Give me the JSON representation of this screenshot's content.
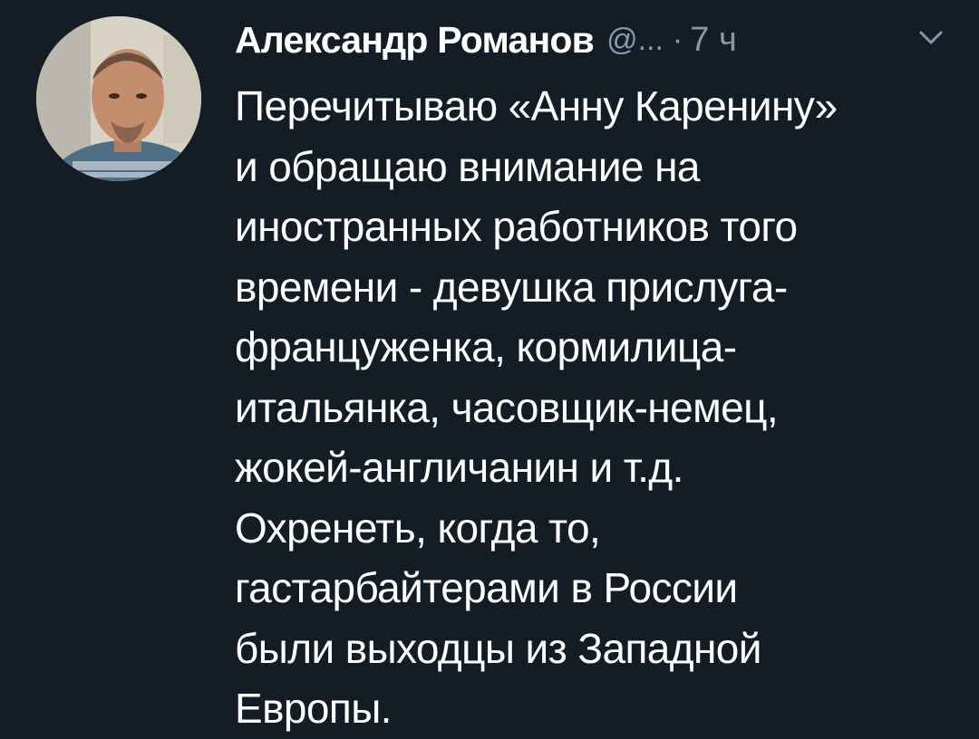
{
  "tweet": {
    "author_name": "Александр Романов",
    "handle": "@...",
    "separator": "·",
    "time": "7 ч",
    "avatar_icon": "user-avatar-photo",
    "menu_icon": "chevron-down-icon",
    "text_lines": [
      "Перечитываю «Анну Каренину»",
      "и обращаю внимание на",
      "иностранных работников того",
      "времени - девушка прислуга-",
      "француженка, кормилица-",
      "итальянка, часовщик-немец,",
      "жокей-англичанин и т.д.",
      "Охренеть, когда то,",
      "гастарбайтерами в России",
      "были выходцы из Западной",
      "Европы."
    ]
  },
  "colors": {
    "background": "#141d26",
    "primary_text": "#ffffff",
    "secondary_text": "#8899a6"
  }
}
